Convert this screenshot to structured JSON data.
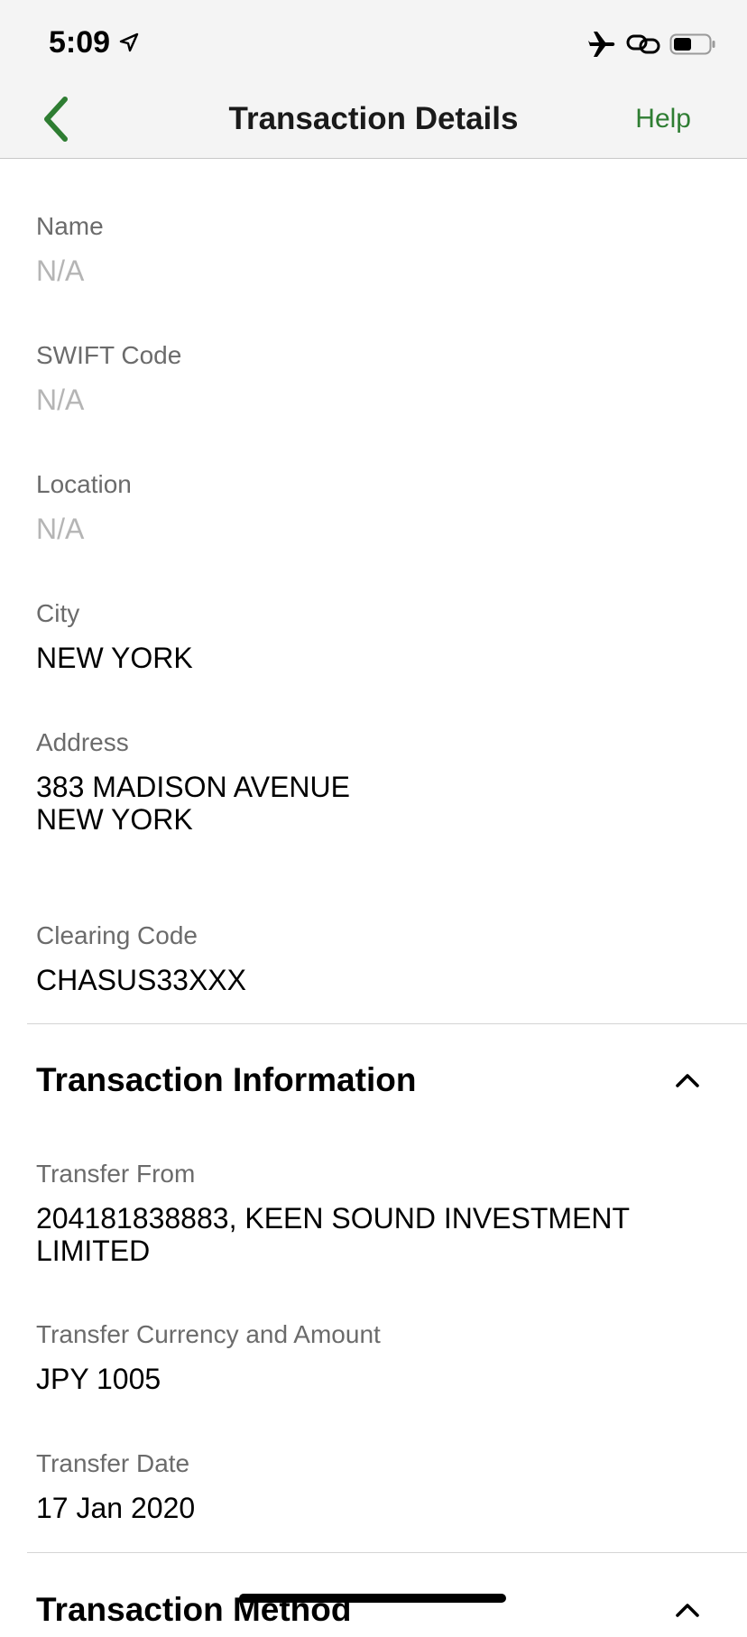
{
  "status_bar": {
    "time": "5:09"
  },
  "nav": {
    "title": "Transaction Details",
    "help_label": "Help"
  },
  "beneficiary_bank": {
    "fields": [
      {
        "label": "Name",
        "value": "N/A"
      },
      {
        "label": "SWIFT Code",
        "value": "N/A"
      },
      {
        "label": "Location",
        "value": "N/A"
      },
      {
        "label": "City",
        "value": "NEW YORK"
      },
      {
        "label": "Address",
        "value_lines": [
          "383 MADISON AVENUE",
          "NEW YORK"
        ]
      },
      {
        "label": "Clearing Code",
        "value": "CHASUS33XXX"
      }
    ]
  },
  "transaction_information": {
    "title": "Transaction Information",
    "fields": [
      {
        "label": "Transfer From",
        "value_lines": [
          "204181838883, KEEN SOUND INVESTMENT",
          "LIMITED"
        ]
      },
      {
        "label": "Transfer Currency and Amount",
        "value": "JPY 1005"
      },
      {
        "label": "Transfer Date",
        "value": "17 Jan 2020"
      }
    ]
  },
  "transaction_method": {
    "title": "Transaction Method"
  },
  "colors": {
    "accent": "#2e7d32",
    "label_gray": "#6b6b6b",
    "na_gray": "#b5b5b5"
  },
  "icons": [
    "location-arrow-icon",
    "airplane-icon",
    "link-icon",
    "battery-icon",
    "back-chevron-icon",
    "chevron-up-icon"
  ]
}
